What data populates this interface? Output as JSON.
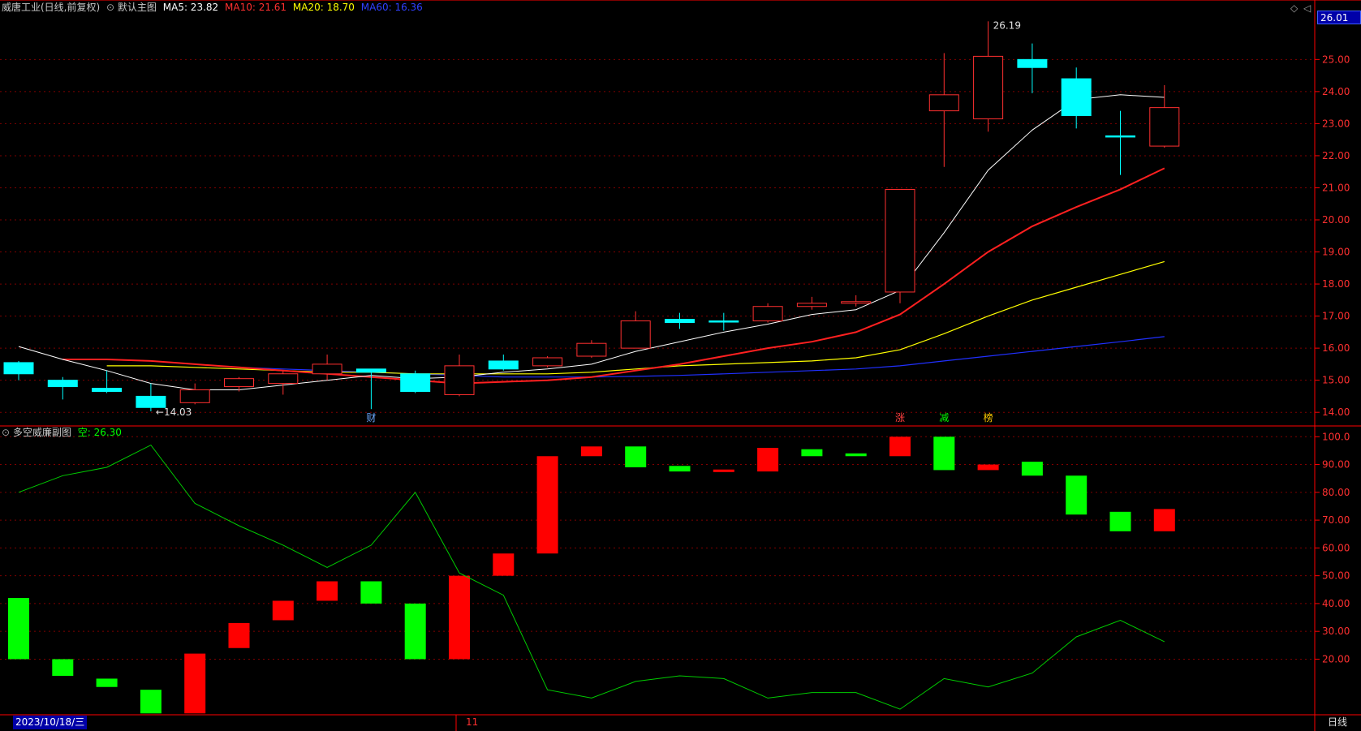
{
  "main_header": {
    "stock_name": "威唐工业(日线,前复权)",
    "panel_name": "默认主图",
    "ma5": "MA5: 23.82",
    "ma10": "MA10: 21.61",
    "ma20": "MA20: 18.70",
    "ma60": "MA60: 16.36"
  },
  "sub_header": {
    "panel_name": "多空威廉副图",
    "value_label": "空: 26.30"
  },
  "price_badge": "26.01",
  "high_label": "26.19",
  "low_label": "←14.03",
  "event_marks": [
    {
      "label": "财",
      "day": 8
    },
    {
      "label": "涨",
      "day": 20
    },
    {
      "label": "减",
      "day": 21
    },
    {
      "label": "榜",
      "day": 22
    }
  ],
  "date_label": "2023/10/18/三",
  "month_label": "11",
  "period_label": "日线",
  "colors": {
    "up": "#ff3030",
    "down": "#00ffff",
    "ma5": "#ffffff",
    "ma10": "#ff2020",
    "ma20": "#ffff00",
    "ma60": "#2030ff",
    "sub_up": "#ff0000",
    "sub_down": "#00ff00",
    "sub_line": "#00cc00",
    "axis": "#ff0000",
    "grid": "#800000"
  },
  "chart_data": [
    {
      "type": "candlestick",
      "name": "默认主图",
      "ylim": [
        13.6,
        26.4
      ],
      "yticks": [
        "14.00",
        "15.00",
        "16.00",
        "17.00",
        "18.00",
        "19.00",
        "20.00",
        "21.00",
        "22.00",
        "23.00",
        "24.00",
        "25.00"
      ],
      "candles": [
        {
          "o": 15.55,
          "c": 15.2,
          "h": 15.6,
          "l": 15.0
        },
        {
          "o": 15.0,
          "c": 14.8,
          "h": 15.1,
          "l": 14.4
        },
        {
          "o": 14.75,
          "c": 14.65,
          "h": 15.3,
          "l": 14.6
        },
        {
          "o": 14.5,
          "c": 14.15,
          "h": 14.9,
          "l": 14.03
        },
        {
          "o": 14.3,
          "c": 14.7,
          "h": 14.9,
          "l": 14.25
        },
        {
          "o": 14.8,
          "c": 15.05,
          "h": 15.1,
          "l": 14.65
        },
        {
          "o": 14.9,
          "c": 15.2,
          "h": 15.3,
          "l": 14.55
        },
        {
          "o": 15.2,
          "c": 15.5,
          "h": 15.8,
          "l": 15.0
        },
        {
          "o": 15.35,
          "c": 15.25,
          "h": 15.35,
          "l": 14.1
        },
        {
          "o": 15.2,
          "c": 14.65,
          "h": 15.3,
          "l": 14.6
        },
        {
          "o": 14.55,
          "c": 15.45,
          "h": 15.8,
          "l": 14.5
        },
        {
          "o": 15.6,
          "c": 15.35,
          "h": 15.8,
          "l": 15.3
        },
        {
          "o": 15.45,
          "c": 15.7,
          "h": 15.75,
          "l": 15.4
        },
        {
          "o": 15.75,
          "c": 16.15,
          "h": 16.25,
          "l": 15.7
        },
        {
          "o": 16.0,
          "c": 16.85,
          "h": 17.15,
          "l": 16.0
        },
        {
          "o": 16.9,
          "c": 16.8,
          "h": 17.1,
          "l": 16.6
        },
        {
          "o": 16.85,
          "c": 16.82,
          "h": 17.1,
          "l": 16.55
        },
        {
          "o": 16.85,
          "c": 17.3,
          "h": 17.4,
          "l": 16.8
        },
        {
          "o": 17.3,
          "c": 17.4,
          "h": 17.6,
          "l": 17.2
        },
        {
          "o": 17.4,
          "c": 17.45,
          "h": 17.65,
          "l": 17.3
        },
        {
          "o": 17.75,
          "c": 20.95,
          "h": 20.95,
          "l": 17.4
        },
        {
          "o": 23.4,
          "c": 23.9,
          "h": 25.2,
          "l": 21.65
        },
        {
          "o": 23.15,
          "c": 25.1,
          "h": 26.19,
          "l": 22.75
        },
        {
          "o": 25.0,
          "c": 24.75,
          "h": 25.5,
          "l": 23.95
        },
        {
          "o": 24.4,
          "c": 23.25,
          "h": 24.75,
          "l": 22.85
        },
        {
          "o": 22.62,
          "c": 22.6,
          "h": 23.4,
          "l": 21.4
        },
        {
          "o": 22.3,
          "c": 23.5,
          "h": 24.2,
          "l": 22.25
        }
      ],
      "ma5": [
        16.05,
        15.65,
        15.3,
        14.9,
        14.7,
        14.7,
        14.85,
        15.0,
        15.15,
        15.05,
        15.1,
        15.25,
        15.35,
        15.5,
        15.9,
        16.2,
        16.5,
        16.75,
        17.05,
        17.2,
        17.8,
        19.6,
        21.55,
        22.8,
        23.75,
        23.9,
        23.82
      ],
      "ma10": [
        15.65,
        15.65,
        15.6,
        15.5,
        15.4,
        15.3,
        15.2,
        15.1,
        15.0,
        14.9,
        14.95,
        15.0,
        15.1,
        15.3,
        15.5,
        15.75,
        16.0,
        16.2,
        16.5,
        17.05,
        18.0,
        19.0,
        19.8,
        20.4,
        20.95,
        21.61
      ],
      "ma20": [
        15.45,
        15.45,
        15.4,
        15.35,
        15.3,
        15.25,
        15.25,
        15.2,
        15.2,
        15.2,
        15.2,
        15.25,
        15.35,
        15.45,
        15.5,
        15.55,
        15.6,
        15.7,
        15.95,
        16.45,
        17.0,
        17.5,
        17.9,
        18.3,
        18.7
      ],
      "ma60": [
        15.4,
        15.35,
        15.3,
        15.25,
        15.2,
        15.15,
        15.1,
        15.1,
        15.1,
        15.12,
        15.15,
        15.2,
        15.25,
        15.3,
        15.35,
        15.45,
        15.6,
        15.75,
        15.9,
        16.05,
        16.2,
        16.36
      ]
    },
    {
      "type": "bar",
      "name": "多空威廉副图",
      "ylim": [
        0,
        103
      ],
      "yticks": [
        "20.00",
        "30.00",
        "40.00",
        "50.00",
        "60.00",
        "70.00",
        "80.00",
        "90.00",
        "100.0"
      ],
      "bars": [
        {
          "bottom": 20.0,
          "top": 42.0,
          "up": false
        },
        {
          "bottom": 14.0,
          "top": 20.0,
          "up": false
        },
        {
          "bottom": 10.0,
          "top": 13.0,
          "up": false
        },
        {
          "bottom": 0.5,
          "top": 9.0,
          "up": false
        },
        {
          "bottom": 0.5,
          "top": 22.0,
          "up": true
        },
        {
          "bottom": 24.0,
          "top": 33.0,
          "up": true
        },
        {
          "bottom": 34.0,
          "top": 41.0,
          "up": true
        },
        {
          "bottom": 41.0,
          "top": 48.0,
          "up": true
        },
        {
          "bottom": 40.0,
          "top": 48.0,
          "up": false
        },
        {
          "bottom": 20.0,
          "top": 40.0,
          "up": false
        },
        {
          "bottom": 20.0,
          "top": 50.0,
          "up": true
        },
        {
          "bottom": 50.0,
          "top": 58.0,
          "up": true
        },
        {
          "bottom": 58.0,
          "top": 93.0,
          "up": true
        },
        {
          "bottom": 93.0,
          "top": 96.5,
          "up": true
        },
        {
          "bottom": 89.0,
          "top": 96.5,
          "up": false
        },
        {
          "bottom": 87.5,
          "top": 89.5,
          "up": false
        },
        {
          "bottom": 87.3,
          "top": 88.2,
          "up": true
        },
        {
          "bottom": 87.5,
          "top": 96.0,
          "up": true
        },
        {
          "bottom": 93.0,
          "top": 95.5,
          "up": false
        },
        {
          "bottom": 93.0,
          "top": 94.0,
          "up": false
        },
        {
          "bottom": 93.0,
          "top": 100.0,
          "up": true
        },
        {
          "bottom": 88.0,
          "top": 100.0,
          "up": false
        },
        {
          "bottom": 88.0,
          "top": 90.0,
          "up": true
        },
        {
          "bottom": 86.0,
          "top": 91.0,
          "up": false
        },
        {
          "bottom": 72.0,
          "top": 86.0,
          "up": false
        },
        {
          "bottom": 66.0,
          "top": 73.0,
          "up": false
        },
        {
          "bottom": 66.0,
          "top": 74.0,
          "up": true
        }
      ],
      "line_name": "空",
      "line": [
        80.0,
        86.0,
        89.0,
        97.0,
        76.0,
        68.0,
        61.0,
        53.0,
        61.0,
        80.0,
        51.0,
        43.0,
        9.0,
        6.0,
        12.0,
        14.0,
        13.0,
        6.0,
        8.0,
        8.0,
        2.0,
        13.0,
        10.0,
        15.0,
        28.0,
        34.0,
        26.3
      ]
    }
  ]
}
